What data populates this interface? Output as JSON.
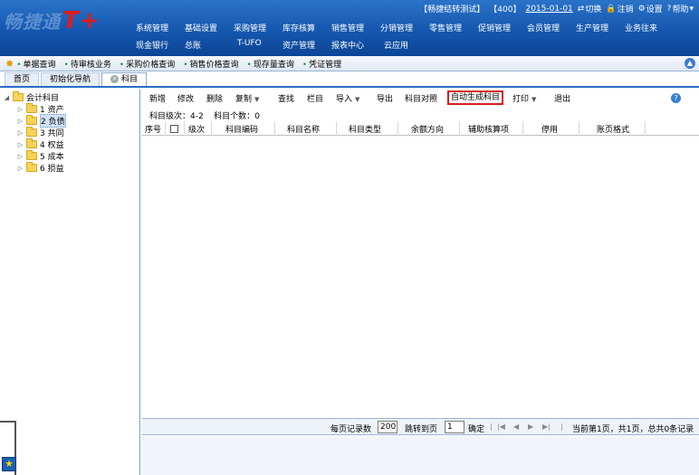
{
  "header": {
    "logo_text": "畅捷通",
    "logo_suffix": "T+",
    "account": "【畅捷结转测试】",
    "account_code": "【400】",
    "date": "2015-01-01",
    "switch_label": "切换",
    "logout_label": "注销",
    "settings_label": "设置",
    "help_label": "帮助",
    "menu_row1": [
      "系统管理",
      "基础设置",
      "采购管理",
      "库存核算",
      "销售管理",
      "分销管理",
      "零售管理",
      "促销管理",
      "会员管理",
      "生产管理",
      "业务往来"
    ],
    "menu_row2": [
      "现金银行",
      "总账",
      "T-UFO",
      "资产管理",
      "报表中心",
      "云应用"
    ]
  },
  "quickbar": {
    "items": [
      "单据查询",
      "待审核业务",
      "采购价格查询",
      "销售价格查询",
      "现存量查询",
      "凭证管理"
    ]
  },
  "tabs": [
    "首页",
    "初始化导航",
    "科目"
  ],
  "tree": {
    "root": "会计科目",
    "children": [
      "1 资产",
      "2 负债",
      "3 共同",
      "4 权益",
      "5 成本",
      "6 损益"
    ]
  },
  "toolbar": {
    "add": "新增",
    "modify": "修改",
    "delete": "删除",
    "copy": "复制",
    "find": "查找",
    "columns": "栏目",
    "import": "导入",
    "export": "导出",
    "mapping": "科目对照",
    "autogen": "自动生成科目",
    "print": "打印",
    "exit": "退出"
  },
  "subinfo": {
    "level_label": "科目级次：",
    "level_value": "4-2",
    "count_label": "科目个数：",
    "count_value": "0"
  },
  "grid": {
    "columns": [
      "序号",
      "级次",
      "科目编码",
      "科目名称",
      "科目类型",
      "余额方向",
      "辅助核算项",
      "停用",
      "账页格式"
    ],
    "rows": []
  },
  "pager": {
    "per_page_label": "每页记录数",
    "per_page_value": "200",
    "goto_label": "跳转到页",
    "goto_value": "1",
    "confirm": "确定",
    "summary": "当前第1页，共1页，总共0条记录"
  }
}
